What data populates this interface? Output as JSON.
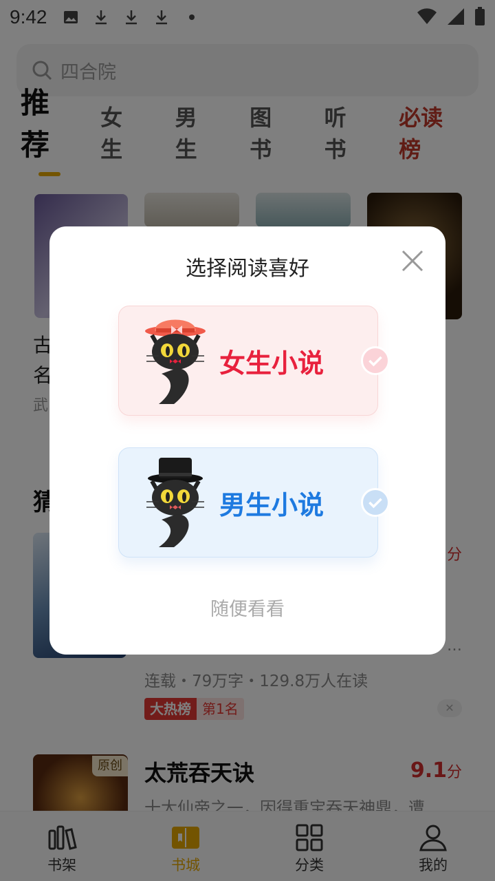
{
  "status_bar": {
    "time": "9:42"
  },
  "search": {
    "placeholder": "四合院"
  },
  "tabs": [
    {
      "label": "推荐",
      "active": true
    },
    {
      "label": "女生"
    },
    {
      "label": "男生"
    },
    {
      "label": "图书"
    },
    {
      "label": "听书"
    },
    {
      "label": "必读榜"
    }
  ],
  "card1": {
    "line1": "古",
    "line2": "名",
    "line3": "武"
  },
  "card2": {
    "section_title_partial": "猜",
    "book1": {
      "score_partial": "分",
      "desc_partial_1": "",
      "desc_partial_2": "…",
      "meta": "连载・79万字・129.8万人在读",
      "tag_hot": "大热榜",
      "tag_rank": "第1名"
    },
    "book2": {
      "badge": "原创",
      "title": "太荒吞天诀",
      "score": "9.1",
      "score_unit": "分",
      "desc": "十大仙帝之一，因得重宝吞天神鼎，遭"
    }
  },
  "bottom_nav": [
    {
      "label": "书架",
      "icon": "bookshelf-icon"
    },
    {
      "label": "书城",
      "icon": "book-open-icon",
      "active": true
    },
    {
      "label": "分类",
      "icon": "grid-icon"
    },
    {
      "label": "我的",
      "icon": "user-icon"
    }
  ],
  "modal": {
    "title": "选择阅读喜好",
    "female_label": "女生小说",
    "male_label": "男生小说",
    "skip_label": "随便看看"
  },
  "colors": {
    "accent": "#e6a800",
    "female": "#e8213d",
    "male": "#1e7ae0"
  }
}
